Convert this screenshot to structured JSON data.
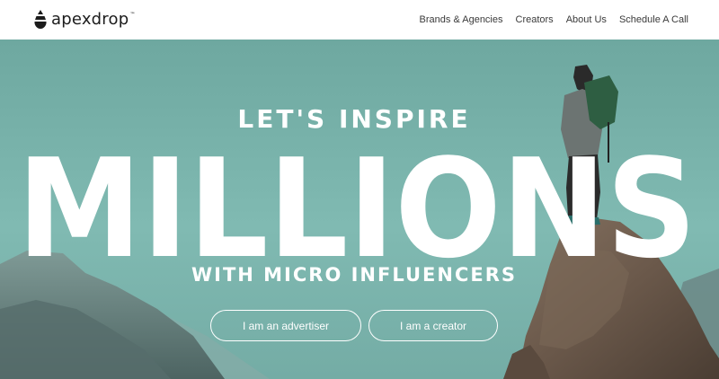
{
  "header": {
    "logo": {
      "icon": "droplet-stack-logo-icon",
      "text": "apexdrop",
      "trademark": "™"
    },
    "nav": [
      {
        "label": "Brands & Agencies"
      },
      {
        "label": "Creators"
      },
      {
        "label": "About Us"
      },
      {
        "label": "Schedule A Call"
      }
    ]
  },
  "hero": {
    "tagline_top": "LET'S INSPIRE",
    "headline": "MILLIONS",
    "tagline_bottom": "WITH MICRO INFLUENCERS",
    "buttons": [
      {
        "label": "I am an advertiser"
      },
      {
        "label": "I am a creator"
      }
    ],
    "background": {
      "description_colors": {
        "sky": "#7fb8b0",
        "mountains": "#5e7a78",
        "rock": "#6b5a4c"
      },
      "icon": "hiker-on-rock-photo"
    }
  },
  "colors": {
    "header_bg": "#ffffff",
    "nav_text": "#3a3a3a",
    "logo_text": "#1c1c1c",
    "hero_text": "#ffffff",
    "hero_bg": "#6fa9a2"
  }
}
